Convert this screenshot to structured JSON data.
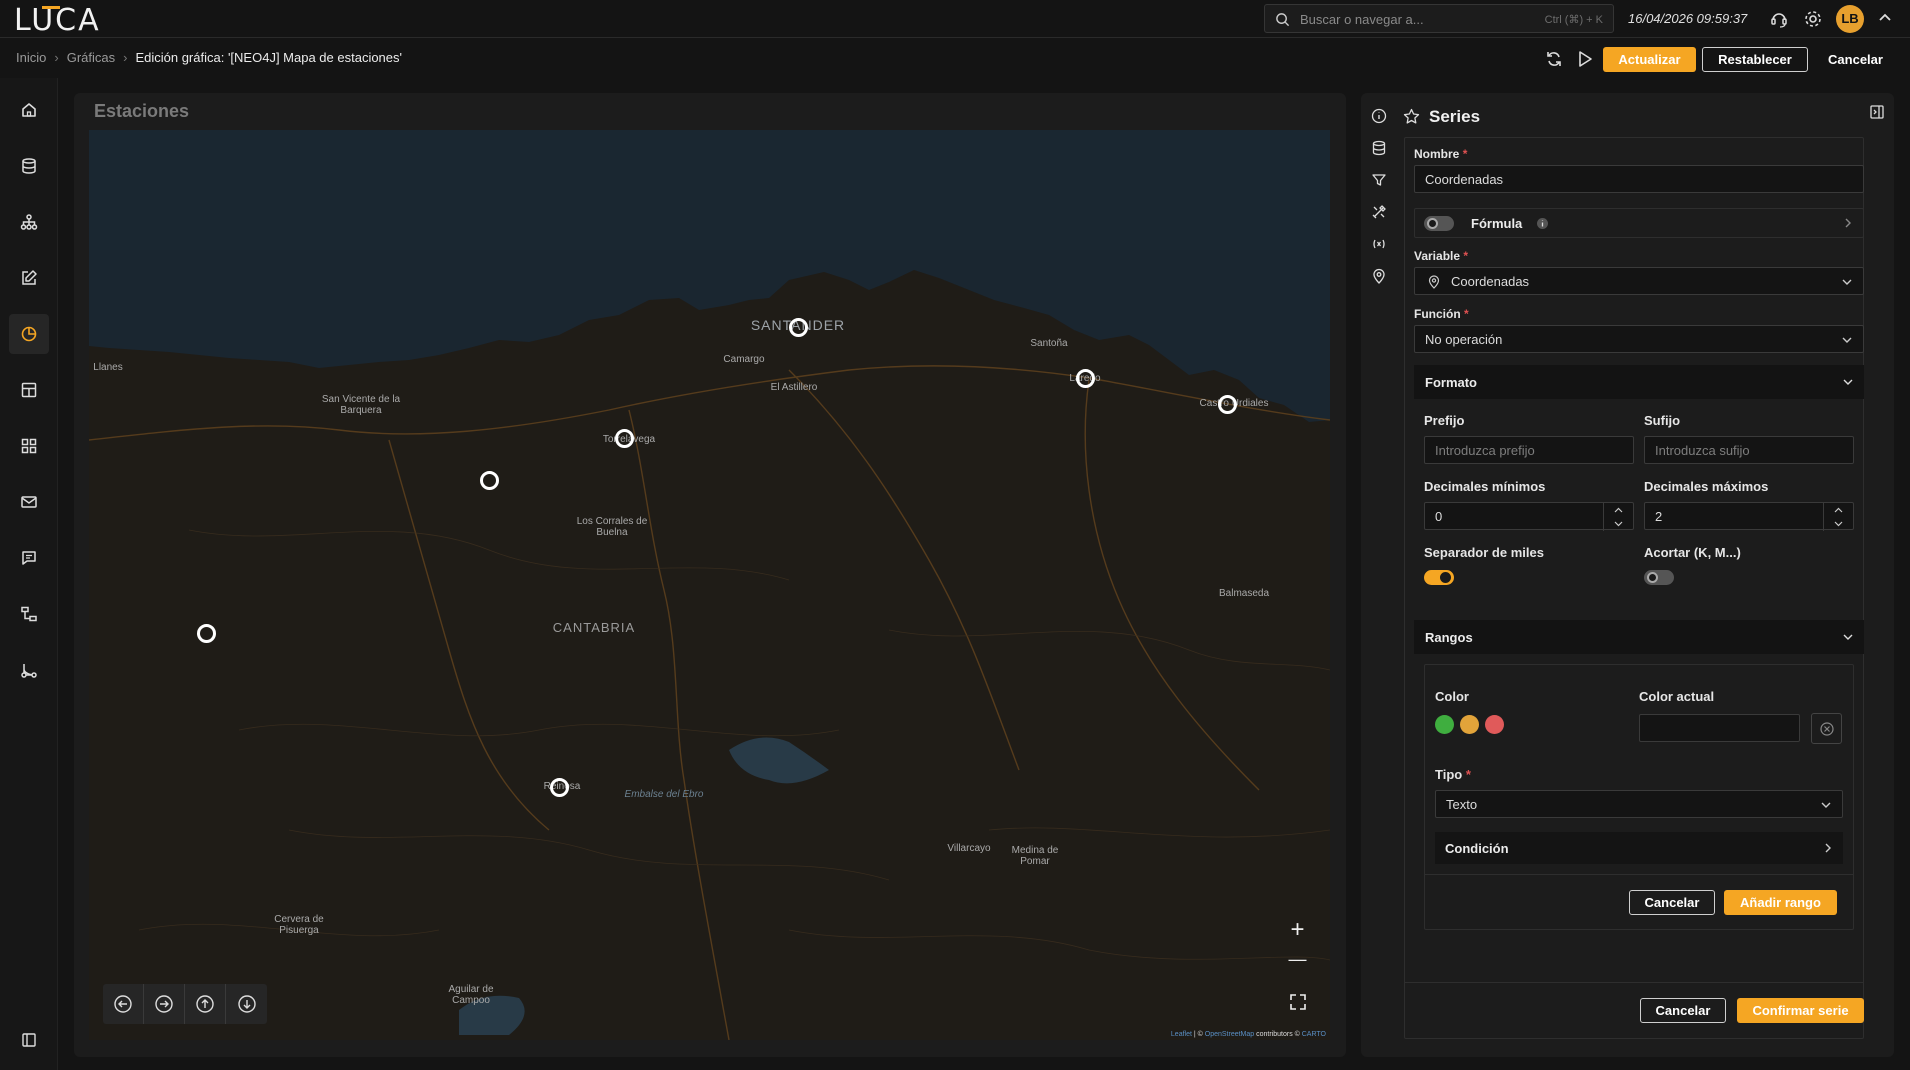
{
  "app": {
    "logo": "LUCA"
  },
  "topbar": {
    "search_placeholder": "Buscar o navegar a...",
    "search_shortcut": "Ctrl (⌘) + K",
    "datetime": "16/04/2026 09:59:37",
    "avatar_initials": "LB"
  },
  "breadcrumb": {
    "items": [
      "Inicio",
      "Gráficas",
      "Edición gráfica: '[NEO4J] Mapa de estaciones'"
    ]
  },
  "toolbar": {
    "update_label": "Actualizar",
    "reset_label": "Restablecer",
    "cancel_label": "Cancelar"
  },
  "sidebar": {
    "items": [
      "home-icon",
      "database-icon",
      "hierarchy-icon",
      "edit-icon",
      "chart-pie-icon",
      "dashboard-icon",
      "apps-icon",
      "mail-icon",
      "message-icon",
      "workflow-icon",
      "route-icon"
    ],
    "active_index": 4,
    "footer": "panel-toggle-icon"
  },
  "chart": {
    "title": "Estaciones",
    "map_labels": {
      "santander": "SANTANDER",
      "camargo": "Camargo",
      "el_astillero": "El Astillero",
      "santona": "Santoña",
      "laredo": "Laredo",
      "castro": "Castro Urdiales",
      "llanes": "Llanes",
      "san_vicente": "San Vicente de la Barquera",
      "torrelavega": "Torrelavega",
      "corrales": "Los Corrales de Buelna",
      "cantabria": "CANTABRIA",
      "balmaseda": "Balmaseda",
      "reinosa": "Reinosa",
      "embalse": "Embalse del Ebro",
      "villarcayo": "Villarcayo",
      "medina": "Medina de Pomar",
      "cervera": "Cervera de Pisuerga",
      "aguilar": "Aguilar de Campoo"
    },
    "attribution": {
      "leaflet": "Leaflet",
      "sep": " | © ",
      "osm": "OpenStreetMap",
      "mid": " contributors © ",
      "carto": "CARTO"
    },
    "zoom_in": "+",
    "zoom_out": "—"
  },
  "series_panel": {
    "title": "Series",
    "nombre_label": "Nombre",
    "nombre_value": "Coordenadas",
    "formula_label": "Fórmula",
    "formula_enabled": false,
    "variable_label": "Variable",
    "variable_value": "Coordenadas",
    "funcion_label": "Función",
    "funcion_value": "No operación",
    "formato": {
      "title": "Formato",
      "prefijo_label": "Prefijo",
      "prefijo_placeholder": "Introduzca prefijo",
      "sufijo_label": "Sufijo",
      "sufijo_placeholder": "Introduzca sufijo",
      "dec_min_label": "Decimales mínimos",
      "dec_min_value": "0",
      "dec_max_label": "Decimales máximos",
      "dec_max_value": "2",
      "separador_label": "Separador de miles",
      "separador_enabled": true,
      "acortar_label": "Acortar (K, M...)",
      "acortar_enabled": false
    },
    "rangos": {
      "title": "Rangos",
      "color_label": "Color",
      "colors": [
        "#3fae3f",
        "#e2a43a",
        "#e05a5a"
      ],
      "color_actual_label": "Color actual",
      "tipo_label": "Tipo",
      "tipo_value": "Texto",
      "condicion_label": "Condición",
      "cancel_label": "Cancelar",
      "add_label": "Añadir rango"
    },
    "footer": {
      "cancel_label": "Cancelar",
      "confirm_label": "Confirmar serie"
    }
  },
  "colors": {
    "accent": "#f5a623",
    "background": "#141414"
  }
}
